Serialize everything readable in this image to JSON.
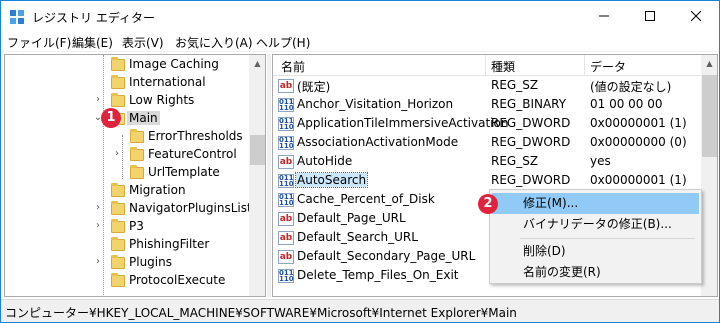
{
  "window": {
    "title": "レジストリ エディター"
  },
  "menu": [
    "ファイル(F)",
    "編集(E)",
    "表示(V)",
    "お気に入り(A)",
    "ヘルプ(H)"
  ],
  "tree": [
    {
      "label": "Image Caching",
      "indent": 1,
      "chevron": ""
    },
    {
      "label": "International",
      "indent": 1,
      "chevron": ""
    },
    {
      "label": "Low Rights",
      "indent": 1,
      "chevron": "›"
    },
    {
      "label": "Main",
      "indent": 1,
      "chevron": "⌄",
      "selected": true
    },
    {
      "label": "ErrorThresholds",
      "indent": 2,
      "chevron": ""
    },
    {
      "label": "FeatureControl",
      "indent": 2,
      "chevron": "›"
    },
    {
      "label": "UrlTemplate",
      "indent": 2,
      "chevron": ""
    },
    {
      "label": "Migration",
      "indent": 1,
      "chevron": ""
    },
    {
      "label": "NavigatorPluginsList",
      "indent": 1,
      "chevron": "›"
    },
    {
      "label": "P3",
      "indent": 1,
      "chevron": "›"
    },
    {
      "label": "PhishingFilter",
      "indent": 1,
      "chevron": ""
    },
    {
      "label": "Plugins",
      "indent": 1,
      "chevron": "›"
    },
    {
      "label": "ProtocolExecute",
      "indent": 1,
      "chevron": ""
    }
  ],
  "list": {
    "headers": {
      "name": "名前",
      "type": "種類",
      "data": "データ"
    },
    "rows": [
      {
        "icon": "ab",
        "name": "(既定)",
        "type": "REG_SZ",
        "data": "(値の設定なし)"
      },
      {
        "icon": "bin",
        "name": "Anchor_Visitation_Horizon",
        "type": "REG_BINARY",
        "data": "01 00 00 00"
      },
      {
        "icon": "bin",
        "name": "ApplicationTileImmersiveActivation",
        "type": "REG_DWORD",
        "data": "0x00000001 (1)"
      },
      {
        "icon": "bin",
        "name": "AssociationActivationMode",
        "type": "REG_DWORD",
        "data": "0x00000000 (0)"
      },
      {
        "icon": "ab",
        "name": "AutoHide",
        "type": "REG_SZ",
        "data": "yes"
      },
      {
        "icon": "bin",
        "name": "AutoSearch",
        "type": "REG_DWORD",
        "data": "0x00000001 (1)",
        "selected": true
      },
      {
        "icon": "bin",
        "name": "Cache_Percent_of_Disk",
        "type": "",
        "data": ""
      },
      {
        "icon": "ab",
        "name": "Default_Page_URL",
        "type": "",
        "data": ""
      },
      {
        "icon": "ab",
        "name": "Default_Search_URL",
        "type": "",
        "data": ""
      },
      {
        "icon": "ab",
        "name": "Default_Secondary_Page_URL",
        "type": "",
        "data": ""
      },
      {
        "icon": "bin",
        "name": "Delete_Temp_Files_On_Exit",
        "type": "",
        "data": ""
      }
    ]
  },
  "context_menu": {
    "items": [
      {
        "label": "修正(M)...",
        "hover": true
      },
      {
        "label": "バイナリデータの修正(B)...",
        "hover": false
      },
      {
        "label": "削除(D)",
        "hover": false
      },
      {
        "label": "名前の変更(R)",
        "hover": false
      }
    ]
  },
  "markers": {
    "m1": "1",
    "m2": "2"
  },
  "status": "コンピューター¥HKEY_LOCAL_MACHINE¥SOFTWARE¥Microsoft¥Internet Explorer¥Main",
  "icons": {
    "sz": "ab",
    "bin": "011\n110"
  },
  "colors": {
    "accent": "#1883d7",
    "marker": "#e0233d",
    "menu_hover": "#91c9f7",
    "folder": "#f3d36b"
  }
}
